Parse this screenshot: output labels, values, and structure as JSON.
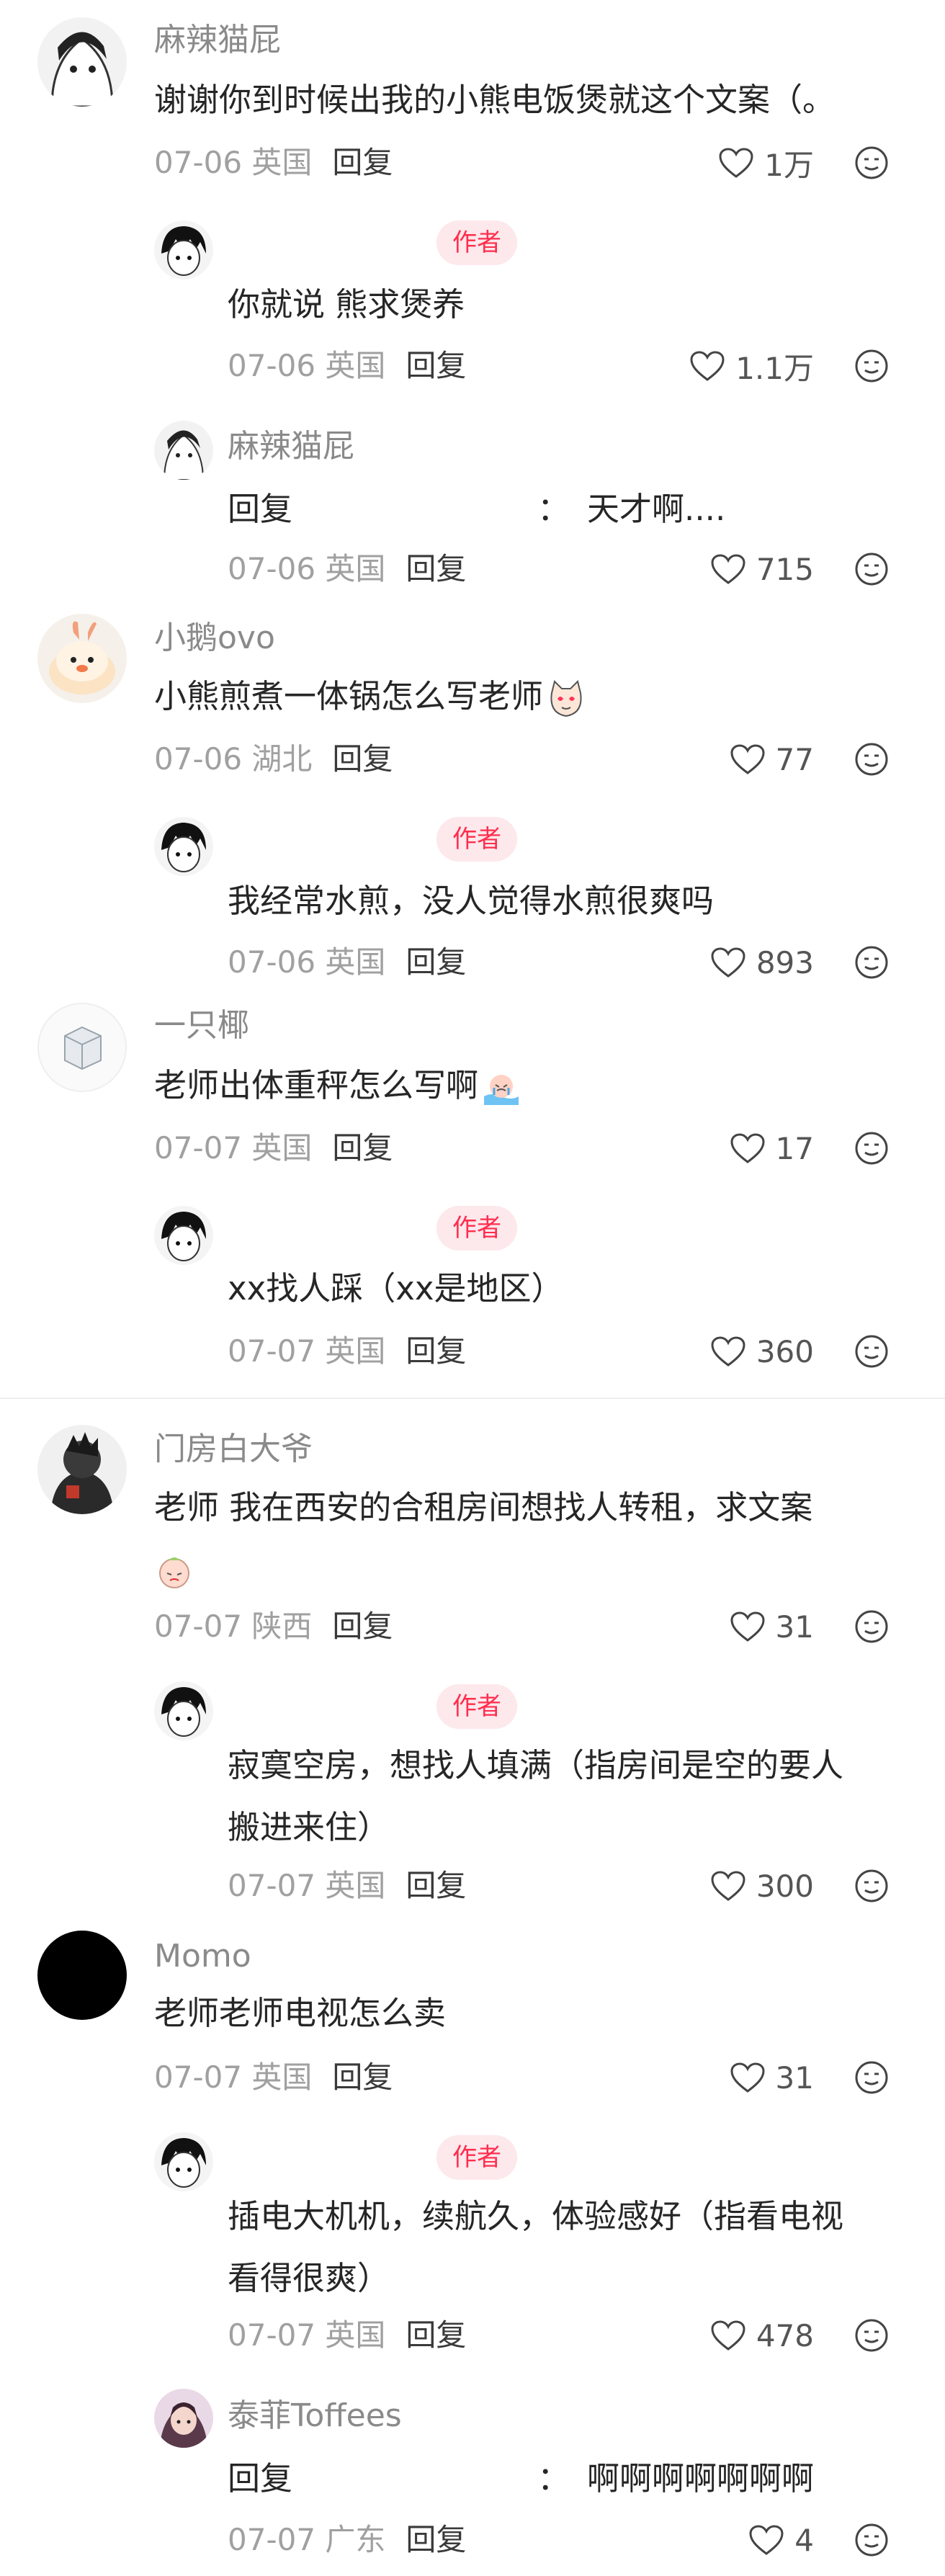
{
  "reply_label": "回复",
  "author_tag": "作者",
  "comments": [
    {
      "user": "麻辣猫屁",
      "text": "谢谢你到时候出我的小熊电饭煲就这个文案（。",
      "date": "07-06",
      "region": "英国",
      "likes": "1万"
    },
    {
      "user": "",
      "is_author": true,
      "text": "你就说 熊求煲养",
      "date": "07-06",
      "region": "英国",
      "likes": "1.1万"
    },
    {
      "user": "麻辣猫屁",
      "reply_prefix": "回复",
      "text": "天才啊....",
      "date": "07-06",
      "region": "英国",
      "likes": "715"
    },
    {
      "user": "小鹅ovo",
      "text": "小熊煎煮一体锅怎么写老师",
      "date": "07-06",
      "region": "湖北",
      "likes": "77"
    },
    {
      "user": "",
      "is_author": true,
      "text": "我经常水煎，没人觉得水煎很爽吗",
      "date": "07-06",
      "region": "英国",
      "likes": "893"
    },
    {
      "user": "一只椰",
      "text": "老师出体重秤怎么写啊",
      "date": "07-07",
      "region": "英国",
      "likes": "17"
    },
    {
      "user": "",
      "is_author": true,
      "text": "xx找人踩（xx是地区）",
      "date": "07-07",
      "region": "英国",
      "likes": "360"
    },
    {
      "user": "门房白大爷",
      "text": "老师 我在西安的合租房间想找人转租，求文案",
      "date": "07-07",
      "region": "陕西",
      "likes": "31"
    },
    {
      "user": "",
      "is_author": true,
      "text_line1": "寂寞空房，想找人填满（指房间是空的要人",
      "text_line2": "搬进来住）",
      "date": "07-07",
      "region": "英国",
      "likes": "300"
    },
    {
      "user": "Momo",
      "text": "老师老师电视怎么卖",
      "date": "07-07",
      "region": "英国",
      "likes": "31"
    },
    {
      "user": "",
      "is_author": true,
      "text_line1": "插电大机机，续航久，体验感好（指看电视",
      "text_line2": "看得很爽）",
      "date": "07-07",
      "region": "英国",
      "likes": "478"
    },
    {
      "user": "泰菲Toffees",
      "reply_prefix": "回复",
      "text": "啊啊啊啊啊啊啊",
      "date": "07-07",
      "region": "广东",
      "likes": "4"
    }
  ],
  "colors": {
    "author_tag_bg": "#fde8ec",
    "author_tag_text": "#ff2e4d",
    "name": "#8a8a8a",
    "meta": "#a0a0a0"
  },
  "icons": [
    "heart-icon",
    "emoji-reaction-icon"
  ]
}
